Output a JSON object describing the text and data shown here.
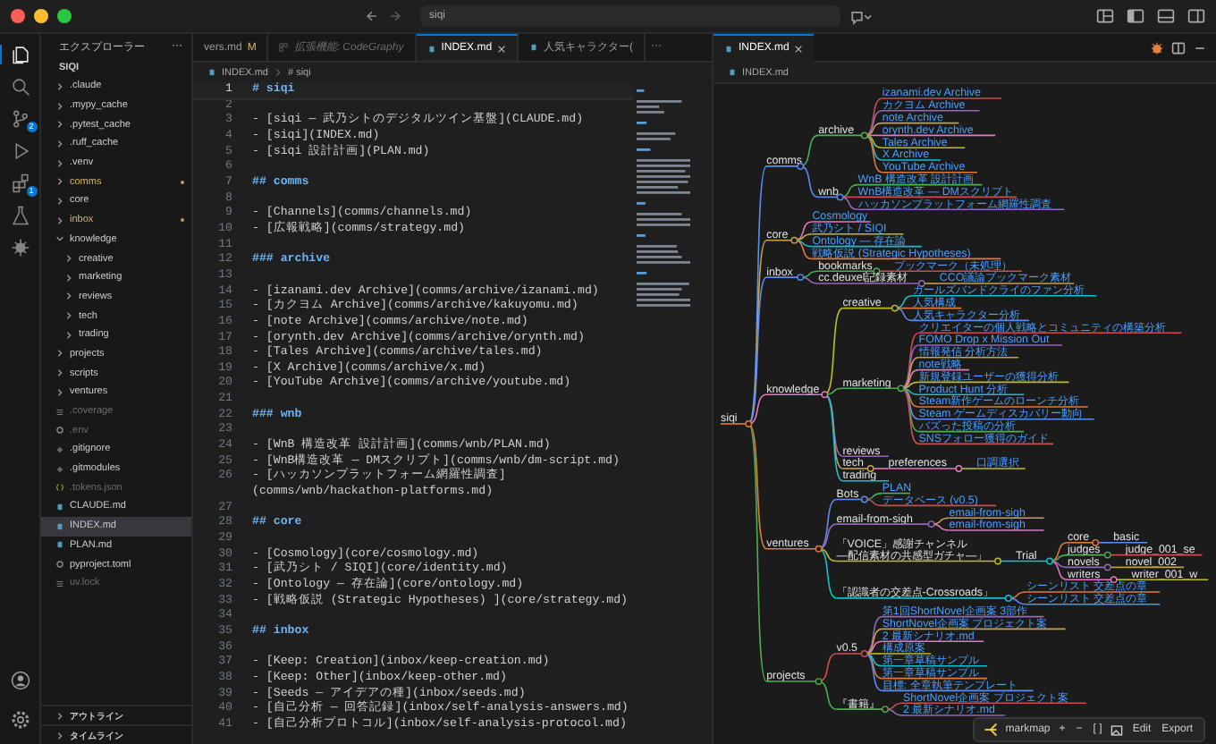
{
  "title_bar": {
    "search": "siqi"
  },
  "activity_bar": [
    {
      "selected": true
    },
    {
      "selected": false
    },
    {
      "selected": false,
      "badge": "2"
    },
    {
      "selected": false
    },
    {
      "selected": false,
      "badge": "1"
    },
    {
      "selected": false
    },
    {
      "selected": false
    }
  ],
  "sidebar": {
    "title": "エクスプローラー",
    "more": "···",
    "root": "SIQI",
    "tree": [
      {
        "label": ".claude",
        "kind": "folder",
        "expanded": false,
        "selected": false
      },
      {
        "label": ".mypy_cache",
        "kind": "folder",
        "expanded": false,
        "selected": false
      },
      {
        "label": ".pytest_cache",
        "kind": "folder",
        "expanded": false,
        "selected": false
      },
      {
        "label": ".ruff_cache",
        "kind": "folder",
        "expanded": false,
        "selected": false
      },
      {
        "label": ".venv",
        "kind": "folder",
        "expanded": false,
        "selected": false
      },
      {
        "label": "comms",
        "kind": "folder",
        "expanded": false,
        "selected": false,
        "modified": true
      },
      {
        "label": "core",
        "kind": "folder",
        "expanded": false,
        "selected": false
      },
      {
        "label": "inbox",
        "kind": "folder",
        "expanded": false,
        "selected": false,
        "modified": true
      },
      {
        "label": "knowledge",
        "kind": "folder",
        "expanded": true,
        "selected": false,
        "children": [
          {
            "label": "creative",
            "kind": "folder",
            "expanded": false,
            "selected": false
          },
          {
            "label": "marketing",
            "kind": "folder",
            "expanded": false,
            "selected": false
          },
          {
            "label": "reviews",
            "kind": "folder",
            "expanded": false,
            "selected": false
          },
          {
            "label": "tech",
            "kind": "folder",
            "expanded": false,
            "selected": false
          },
          {
            "label": "trading",
            "kind": "folder",
            "expanded": false,
            "selected": false
          }
        ]
      },
      {
        "label": "projects",
        "kind": "folder",
        "expanded": false,
        "selected": false
      },
      {
        "label": "scripts",
        "kind": "folder",
        "expanded": false,
        "selected": false
      },
      {
        "label": "ventures",
        "kind": "folder",
        "expanded": false,
        "selected": false
      },
      {
        "label": ".coverage",
        "kind": "lines",
        "selected": false,
        "ignored": true
      },
      {
        "label": ".env",
        "kind": "config",
        "selected": false,
        "ignored": true
      },
      {
        "label": ".gitignore",
        "kind": "git",
        "selected": false
      },
      {
        "label": ".gitmodules",
        "kind": "git",
        "selected": false
      },
      {
        "label": ".tokens.json",
        "kind": "json",
        "selected": false,
        "ignored": true
      },
      {
        "label": "CLAUDE.md",
        "kind": "md",
        "selected": false
      },
      {
        "label": "INDEX.md",
        "kind": "md",
        "selected": true
      },
      {
        "label": "PLAN.md",
        "kind": "md",
        "selected": false
      },
      {
        "label": "pyproject.toml",
        "kind": "config",
        "selected": false
      },
      {
        "label": "uv.lock",
        "kind": "lines",
        "selected": false,
        "ignored": true
      }
    ],
    "sections": [
      "アウトライン",
      "タイムライン"
    ]
  },
  "editor": {
    "tabs": [
      {
        "label": "vers.md",
        "badge": "M",
        "kind": "file",
        "selected": false
      },
      {
        "label": "拡張機能: CodeGraphy",
        "kind": "extension",
        "selected": false
      },
      {
        "label": "INDEX.md",
        "kind": "file",
        "selected": true
      },
      {
        "label": "人気キャラクター(",
        "kind": "file",
        "selected": false
      }
    ],
    "tab_overflow": "···",
    "breadcrumb": {
      "file": "INDEX.md",
      "symbol": "# siqi"
    },
    "lines": [
      {
        "n": "1",
        "kind": "h1",
        "text": "# siqi",
        "current": true
      },
      {
        "n": "2",
        "kind": "blank",
        "current": false
      },
      {
        "n": "3",
        "kind": "link",
        "text": "- [siqi — 武乃シトのデジタルツイン基盤](CLAUDE.md)",
        "current": false
      },
      {
        "n": "4",
        "kind": "link",
        "text": "- [siqi](INDEX.md)",
        "current": false
      },
      {
        "n": "5",
        "kind": "link",
        "text": "- [siqi 設計計画](PLAN.md)",
        "current": false
      },
      {
        "n": "6",
        "kind": "blank",
        "current": false
      },
      {
        "n": "7",
        "kind": "h2",
        "text": "## comms",
        "current": false
      },
      {
        "n": "8",
        "kind": "blank",
        "current": false
      },
      {
        "n": "9",
        "kind": "link",
        "text": "- [Channels](comms/channels.md)",
        "current": false
      },
      {
        "n": "10",
        "kind": "link",
        "text": "- [広報戦略](comms/strategy.md)",
        "current": false
      },
      {
        "n": "11",
        "kind": "blank",
        "current": false
      },
      {
        "n": "12",
        "kind": "h3",
        "text": "### archive",
        "current": false
      },
      {
        "n": "13",
        "kind": "blank",
        "current": false
      },
      {
        "n": "14",
        "kind": "link",
        "text": "- [izanami.dev Archive](comms/archive/izanami.md)",
        "current": false
      },
      {
        "n": "15",
        "kind": "link",
        "text": "- [カクヨム Archive](comms/archive/kakuyomu.md)",
        "current": false
      },
      {
        "n": "16",
        "kind": "link",
        "text": "- [note Archive](comms/archive/note.md)",
        "current": false
      },
      {
        "n": "17",
        "kind": "link",
        "text": "- [orynth.dev Archive](comms/archive/orynth.md)",
        "current": false
      },
      {
        "n": "18",
        "kind": "link",
        "text": "- [Tales Archive](comms/archive/tales.md)",
        "current": false
      },
      {
        "n": "19",
        "kind": "link",
        "text": "- [X Archive](comms/archive/x.md)",
        "current": false
      },
      {
        "n": "20",
        "kind": "link",
        "text": "- [YouTube Archive](comms/archive/youtube.md)",
        "current": false
      },
      {
        "n": "21",
        "kind": "blank",
        "current": false
      },
      {
        "n": "22",
        "kind": "h3",
        "text": "### wnb",
        "current": false
      },
      {
        "n": "23",
        "kind": "blank",
        "current": false
      },
      {
        "n": "24",
        "kind": "link",
        "text": "- [WnB 構造改革 設計計画](comms/wnb/PLAN.md)",
        "current": false
      },
      {
        "n": "25",
        "kind": "link",
        "text": "- [WnB構造改革 — DMスクリプト](comms/wnb/dm-script.md)",
        "current": false
      },
      {
        "n": "26",
        "kind": "link",
        "text": "- [ハッカソンプラットフォーム網羅性調査](comms/wnb/hackathon-platforms.md)",
        "current": false
      },
      {
        "n": "27",
        "kind": "blank",
        "current": false
      },
      {
        "n": "28",
        "kind": "h2",
        "text": "## core",
        "current": false
      },
      {
        "n": "29",
        "kind": "blank",
        "current": false
      },
      {
        "n": "30",
        "kind": "link",
        "text": "- [Cosmology](core/cosmology.md)",
        "current": false
      },
      {
        "n": "31",
        "kind": "link",
        "text": "- [武乃シト / SIQI](core/identity.md)",
        "current": false
      },
      {
        "n": "32",
        "kind": "link",
        "text": "- [Ontology — 存在論](core/ontology.md)",
        "current": false
      },
      {
        "n": "33",
        "kind": "link",
        "text": "- [戦略仮説 (Strategic Hypotheses) ](core/strategy.md)",
        "current": false
      },
      {
        "n": "34",
        "kind": "blank",
        "current": false
      },
      {
        "n": "35",
        "kind": "h2",
        "text": "## inbox",
        "current": false
      },
      {
        "n": "36",
        "kind": "blank",
        "current": false
      },
      {
        "n": "37",
        "kind": "link",
        "text": "- [Keep: Creation](inbox/keep-creation.md)",
        "current": false
      },
      {
        "n": "38",
        "kind": "link",
        "text": "- [Keep: Other](inbox/keep-other.md)",
        "current": false
      },
      {
        "n": "39",
        "kind": "link",
        "text": "- [Seeds — アイデアの種](inbox/seeds.md)",
        "current": false
      },
      {
        "n": "40",
        "kind": "link",
        "text": "- [自己分析 — 回答記録](inbox/self-analysis-answers.md)",
        "current": false
      },
      {
        "n": "41",
        "kind": "link",
        "text": "- [自己分析プロトコル](inbox/self-analysis-protocol.md)",
        "current": false
      }
    ]
  },
  "preview": {
    "tab": "INDEX.md",
    "breadcrumb": "INDEX.md",
    "markmap": {
      "label": "siqi",
      "link": false,
      "children": [
        {
          "label": "comms",
          "link": false,
          "children": [
            {
              "label": "archive",
              "link": false,
              "children": [
                {
                  "label": "izanami.dev Archive",
                  "link": true
                },
                {
                  "label": "カクヨム Archive",
                  "link": true
                },
                {
                  "label": "note Archive",
                  "link": true
                },
                {
                  "label": "orynth.dev Archive",
                  "link": true
                },
                {
                  "label": "Tales Archive",
                  "link": true
                },
                {
                  "label": "X Archive",
                  "link": true
                },
                {
                  "label": "YouTube Archive",
                  "link": true
                }
              ]
            },
            {
              "label": "wnb",
              "link": false,
              "children": [
                {
                  "label": "WnB 構造改革 設計計画",
                  "link": true
                },
                {
                  "label": "WnB構造改革 — DMスクリプト",
                  "link": true
                },
                {
                  "label": "ハッカソンプラットフォーム網羅性調査",
                  "link": true
                }
              ]
            }
          ]
        },
        {
          "label": "core",
          "link": false,
          "children": [
            {
              "label": "Cosmology",
              "link": true
            },
            {
              "label": "武乃シト / SIQI",
              "link": true
            },
            {
              "label": "Ontology — 存在論",
              "link": true
            },
            {
              "label": "戦略仮説 (Strategic Hypotheses)",
              "link": true
            }
          ]
        },
        {
          "label": "inbox",
          "link": false,
          "children": [
            {
              "label": "bookmarks",
              "link": false,
              "children": [
                {
                  "label": "ブックマーク（未処理）",
                  "link": true
                }
              ]
            },
            {
              "label": "cc.deuxel記録素材",
              "link": false,
              "children": [
                {
                  "label": "CCO議論ブックマーク素材",
                  "link": true
                }
              ]
            }
          ]
        },
        {
          "label": "knowledge",
          "link": false,
          "children": [
            {
              "label": "creative",
              "link": false,
              "children": [
                {
                  "label": "ガールズバンドクライのファン分析",
                  "link": true
                },
                {
                  "label": "人気構成",
                  "link": true
                },
                {
                  "label": "人気キャラクター分析",
                  "link": true
                }
              ]
            },
            {
              "label": "marketing",
              "link": false,
              "children": [
                {
                  "label": "クリエイターの個人戦略とコミュニティの構築分析",
                  "link": true
                },
                {
                  "label": "FOMO Drop x Mission Out",
                  "link": true
                },
                {
                  "label": "情報発信 分析方法",
                  "link": true
                },
                {
                  "label": "note戦略",
                  "link": true
                },
                {
                  "label": "新規登録ユーザーの獲得分析",
                  "link": true
                },
                {
                  "label": "Product Hunt 分析",
                  "link": true
                },
                {
                  "label": "Steam新作ゲームのローンチ分析",
                  "link": true
                },
                {
                  "label": "Steam ゲームディスカバリー動向",
                  "link": true
                },
                {
                  "label": "バズった投稿の分析",
                  "link": true
                },
                {
                  "label": "SNSフォロー獲得のガイド",
                  "link": true
                }
              ]
            },
            {
              "label": "reviews",
              "link": false
            },
            {
              "label": "tech",
              "link": false,
              "children": [
                {
                  "label": "preferences",
                  "link": false,
                  "children": [
                    {
                      "label": "口調選択",
                      "link": true
                    }
                  ]
                }
              ]
            },
            {
              "label": "trading",
              "link": false
            }
          ]
        },
        {
          "label": "ventures",
          "link": false,
          "children": [
            {
              "label": "Bots",
              "link": false,
              "children": [
                {
                  "label": "PLAN",
                  "link": true
                },
                {
                  "label": "データベース (v0.5)",
                  "link": true
                }
              ]
            },
            {
              "label": "email-from-sigh",
              "link": false,
              "children": [
                {
                  "label": "email-from-sigh",
                  "link": true
                },
                {
                  "label": "email-from-sigh",
                  "link": true
                }
              ]
            },
            {
              "label": "「VOICE」感謝チャンネル ―配信素材の共感型ガチャ―」",
              "link": false,
              "children": [
                {
                  "label": "Trial",
                  "link": false,
                  "children": [
                    {
                      "label": "core",
                      "link": false,
                      "children": [
                        {
                          "label": "basic",
                          "link": false
                        }
                      ]
                    },
                    {
                      "label": "judges",
                      "link": false,
                      "children": [
                        {
                          "label": "judge_001_se",
                          "link": false
                        }
                      ]
                    },
                    {
                      "label": "novels",
                      "link": false,
                      "children": [
                        {
                          "label": "novel_002",
                          "link": false
                        }
                      ]
                    },
                    {
                      "label": "writers",
                      "link": false,
                      "children": [
                        {
                          "label": "writer_001_w",
                          "link": false
                        }
                      ]
                    }
                  ]
                }
              ]
            },
            {
              "label": "「認識者の交差点-Crossroads」",
              "link": false,
              "children": [
                {
                  "label": "シーンリスト 交差点の章",
                  "link": true
                },
                {
                  "label": "シーンリスト 交差点の章",
                  "link": true
                }
              ]
            }
          ]
        },
        {
          "label": "projects",
          "link": false,
          "children": [
            {
              "label": "v0.5",
              "link": false,
              "children": [
                {
                  "label": "第1回ShortNovel企画案 3部作",
                  "link": true
                },
                {
                  "label": "ShortNovel企画案 プロジェクト案",
                  "link": true
                },
                {
                  "label": "2 最新シナリオ.md",
                  "link": true
                },
                {
                  "label": "構成原案",
                  "link": true
                },
                {
                  "label": "第一章草稿サンプル",
                  "link": true
                },
                {
                  "label": "第一章草稿サンプル",
                  "link": true
                },
                {
                  "label": "目標: 全章執筆テンプレート",
                  "link": true
                }
              ]
            },
            {
              "label": "『書籍』",
              "link": false,
              "children": [
                {
                  "label": "ShortNovel企画案 プロジェクト案",
                  "link": true
                },
                {
                  "label": "2 最新シナリオ.md",
                  "link": true
                }
              ]
            }
          ]
        }
      ]
    },
    "toolbar": {
      "title": "markmap",
      "zoom_in": "+",
      "zoom_out": "−",
      "fit": "[ ]",
      "edit": "Edit",
      "export": "Export"
    }
  }
}
